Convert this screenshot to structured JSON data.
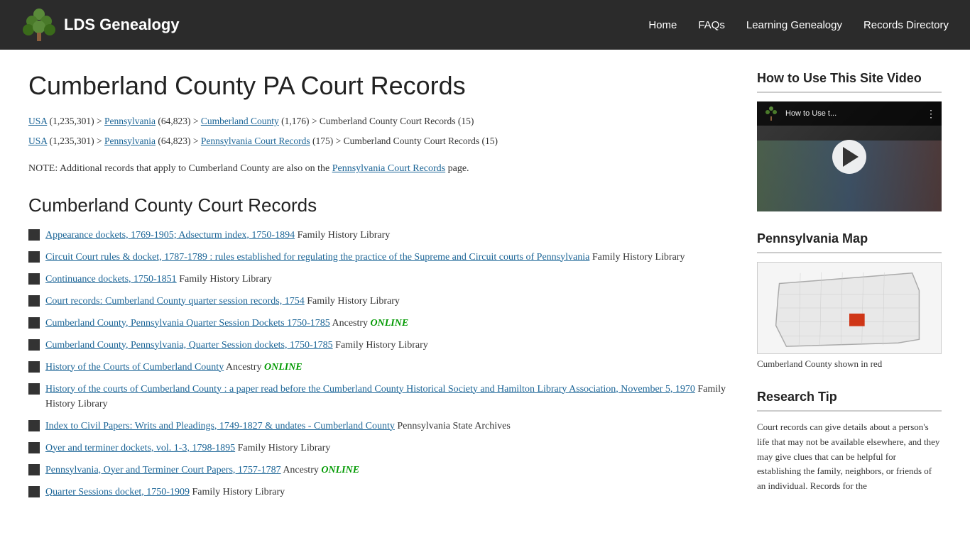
{
  "header": {
    "logo_text": "LDS Genealogy",
    "nav_items": [
      {
        "label": "Home",
        "id": "home"
      },
      {
        "label": "FAQs",
        "id": "faqs"
      },
      {
        "label": "Learning Genealogy",
        "id": "learning"
      },
      {
        "label": "Records Directory",
        "id": "records-dir"
      }
    ]
  },
  "main": {
    "page_title": "Cumberland County PA Court Records",
    "breadcrumbs": [
      {
        "items": [
          {
            "text": "USA",
            "link": true
          },
          {
            "text": " (1,235,301) > ",
            "link": false
          },
          {
            "text": "Pennsylvania",
            "link": true
          },
          {
            "text": " (64,823) > ",
            "link": false
          },
          {
            "text": "Cumberland County",
            "link": true
          },
          {
            "text": " (1,176) > Cumberland County Court Records (15)",
            "link": false
          }
        ]
      },
      {
        "items": [
          {
            "text": "USA",
            "link": true
          },
          {
            "text": " (1,235,301) > ",
            "link": false
          },
          {
            "text": "Pennsylvania",
            "link": true
          },
          {
            "text": " (64,823) > ",
            "link": false
          },
          {
            "text": "Pennsylvania Court Records",
            "link": true
          },
          {
            "text": " (175) > Cumberland County Court Records (15)",
            "link": false
          }
        ]
      }
    ],
    "note": {
      "prefix": "NOTE: Additional records that apply to Cumberland County are also on the ",
      "link_text": "Pennsylvania Court Records",
      "suffix": " page."
    },
    "section_title": "Cumberland County Court Records",
    "records": [
      {
        "link": "Appearance dockets, 1769-1905; Adsecturm index, 1750-1894",
        "source": " Family History Library",
        "online": false
      },
      {
        "link": "Circuit Court rules & docket, 1787-1789 : rules established for regulating the practice of the Supreme and Circuit courts of Pennsylvania",
        "source": " Family History Library",
        "online": false
      },
      {
        "link": "Continuance dockets, 1750-1851",
        "source": " Family History Library",
        "online": false
      },
      {
        "link": "Court records: Cumberland County quarter session records, 1754",
        "source": " Family History Library",
        "online": false
      },
      {
        "link": "Cumberland County, Pennsylvania Quarter Session Dockets 1750-1785",
        "source": " Ancestry ",
        "online": true,
        "online_label": "ONLINE"
      },
      {
        "link": "Cumberland County, Pennsylvania, Quarter Session dockets, 1750-1785",
        "source": " Family History Library",
        "online": false
      },
      {
        "link": "History of the Courts of Cumberland County",
        "source": " Ancestry ",
        "online": true,
        "online_label": "ONLINE"
      },
      {
        "link": "History of the courts of Cumberland County : a paper read before the Cumberland County Historical Society and Hamilton Library Association, November 5, 1970",
        "source": " Family History Library",
        "online": false
      },
      {
        "link": "Index to Civil Papers: Writs and Pleadings, 1749-1827 & undates - Cumberland County",
        "source": " Pennsylvania State Archives",
        "online": false
      },
      {
        "link": "Oyer and terminer dockets, vol. 1-3, 1798-1895",
        "source": " Family History Library",
        "online": false
      },
      {
        "link": "Pennsylvania, Oyer and Terminer Court Papers, 1757-1787",
        "source": " Ancestry ",
        "online": true,
        "online_label": "ONLINE"
      },
      {
        "link": "Quarter Sessions docket, 1750-1909",
        "source": " Family History Library",
        "online": false
      }
    ]
  },
  "sidebar": {
    "video_section": {
      "title": "How to Use This Site Video",
      "video_title": "How to Use t..."
    },
    "map_section": {
      "title": "Pennsylvania Map",
      "caption": "Cumberland County shown in red"
    },
    "tip_section": {
      "title": "Research Tip",
      "text": "Court records can give details about a person's life that may not be available elsewhere, and they may give clues that can be helpful for establishing the family, neighbors, or friends of an individual.  Records for the"
    }
  }
}
